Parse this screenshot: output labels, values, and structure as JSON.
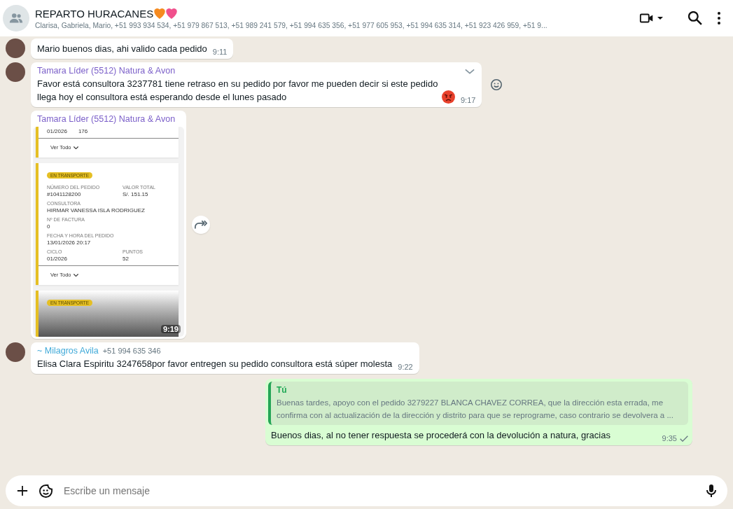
{
  "header": {
    "title": "REPARTO HURACANES",
    "members": "Clarisa, Gabriela, Mario, +51 993 934 534, +51 979 867 513, +51 989 241 579, +51 994 635 356, +51 977 605 953, +51 994 635 314, +51 923 426 959, +51 9..."
  },
  "messages": [
    {
      "kind": "text",
      "avatar": true,
      "text": "Mario buenos dias, ahi valido cada pedido",
      "time": "9:11"
    },
    {
      "kind": "text",
      "avatar": true,
      "sender": "Tamara Líder (5512) Natura & Avon",
      "color": "#7b5fc9",
      "text": "Favor está consultora 3237781 tiene retraso en su pedido  por favor me pueden decir si este pedido llega hoy el consultora está esperando desde el lunes pasado",
      "angry_emoji": true,
      "time": "9:17",
      "menu": true,
      "react": true
    },
    {
      "kind": "image",
      "avatar": false,
      "sender": "Tamara Líder (5512) Natura & Avon",
      "color": "#7b5fc9",
      "time": "9:19",
      "forward": true,
      "shot": {
        "top_values": [
          "01/2026",
          "176"
        ],
        "top_link": "Ver Todo",
        "card": {
          "badge": "EN TRANSPORTE",
          "rows": [
            [
              {
                "label": "NÚMERO DEL PEDIDO",
                "value": "#1041128200"
              },
              {
                "label": "VALOR TOTAL",
                "value": "S/. 151.15"
              }
            ],
            [
              {
                "label": "CONSULTORA",
                "value": "HIRMAR VANESSA ISLA RODRIGUEZ"
              }
            ],
            [
              {
                "label": "Nº DE FACTURA",
                "value": "0"
              }
            ],
            [
              {
                "label": "FECHA Y HORA DEL PEDIDO",
                "value": "13/01/2026 20:17"
              }
            ],
            [
              {
                "label": "CICLO",
                "value": "01/2026"
              },
              {
                "label": "PUNTOS",
                "value": "52"
              }
            ]
          ],
          "link": "Ver Todo"
        },
        "bottom_badge": "EN TRANSPORTE"
      }
    },
    {
      "kind": "text",
      "avatar": true,
      "sender": "~ Milagros Avila",
      "color": "#3fa9d8",
      "phone": "+51 994 635 346",
      "text": "Elisa Clara Espiritu 3247658por favor entregen su pedido consultora está súper molesta",
      "time": "9:22"
    },
    {
      "kind": "outgoing",
      "quote": {
        "author": "Tú",
        "text": "Buenas tardes, apoyo con el pedido 3279227 BLANCA CHAVEZ CORREA, que la dirección esta errada, me confirma con al actualización de la dirección y distrito para que se reprograme, caso contrario se devolvera a ..."
      },
      "text": "Buenos dias, al no tener respuesta se procederá con la devolución a natura, gracias",
      "time": "9:35",
      "delivered": false
    }
  ],
  "composer": {
    "placeholder": "Escribe un mensaje"
  }
}
